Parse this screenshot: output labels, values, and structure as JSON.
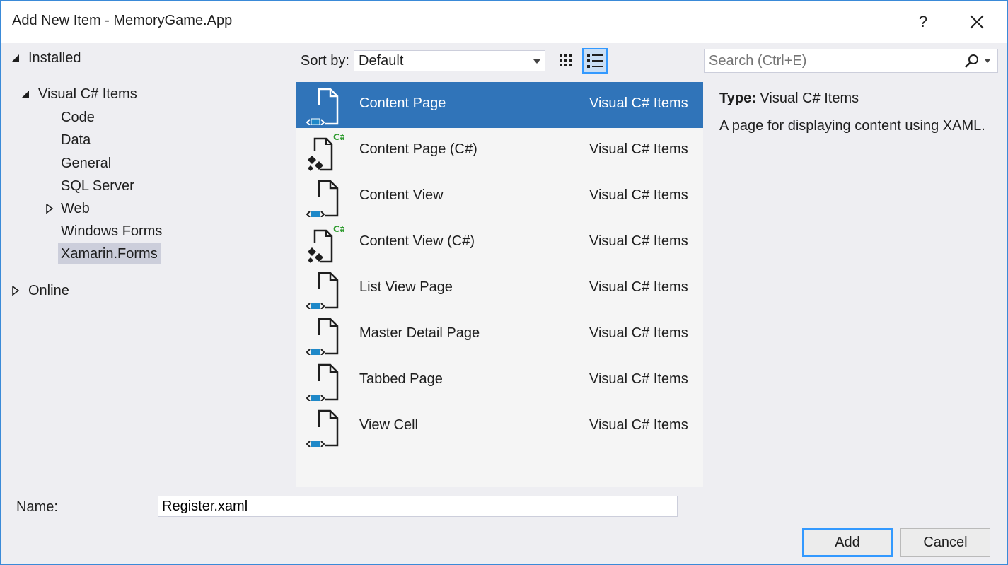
{
  "window": {
    "title": "Add New Item - MemoryGame.App",
    "help_label": "?",
    "close_icon": "close-icon"
  },
  "tree": {
    "installed": "Installed",
    "visual_csharp": "Visual C# Items",
    "children": [
      {
        "label": "Code"
      },
      {
        "label": "Data"
      },
      {
        "label": "General"
      },
      {
        "label": "SQL Server"
      },
      {
        "label": "Web"
      },
      {
        "label": "Windows Forms"
      },
      {
        "label": "Xamarin.Forms",
        "selected": true
      }
    ],
    "online": "Online"
  },
  "toolbar": {
    "sort_label": "Sort by:",
    "sort_value": "Default",
    "view_modes": [
      "small-icons-view",
      "list-view"
    ],
    "active_view": "list-view",
    "search_placeholder": "Search (Ctrl+E)"
  },
  "items": [
    {
      "name": "Content Page",
      "category": "Visual C# Items",
      "icon": "xaml-page-icon",
      "selected": true
    },
    {
      "name": "Content Page (C#)",
      "category": "Visual C# Items",
      "icon": "csharp-page-icon"
    },
    {
      "name": "Content View",
      "category": "Visual C# Items",
      "icon": "xaml-page-icon"
    },
    {
      "name": "Content View (C#)",
      "category": "Visual C# Items",
      "icon": "csharp-page-icon"
    },
    {
      "name": "List View Page",
      "category": "Visual C# Items",
      "icon": "xaml-page-icon"
    },
    {
      "name": "Master Detail Page",
      "category": "Visual C# Items",
      "icon": "xaml-page-icon"
    },
    {
      "name": "Tabbed Page",
      "category": "Visual C# Items",
      "icon": "xaml-page-icon"
    },
    {
      "name": "View Cell",
      "category": "Visual C# Items",
      "icon": "xaml-page-icon"
    }
  ],
  "details": {
    "type_label": "Type:",
    "type_value": "Visual C# Items",
    "description": "A page for displaying content using XAML."
  },
  "footer": {
    "name_label": "Name:",
    "name_value": "Register.xaml",
    "add_label": "Add",
    "cancel_label": "Cancel"
  },
  "colors": {
    "accent": "#3074b9",
    "border_accent": "#3399ff",
    "window_border": "#3a8ad8",
    "xaml_blue": "#1e88c8",
    "csharp_green": "#2e9b2e"
  }
}
